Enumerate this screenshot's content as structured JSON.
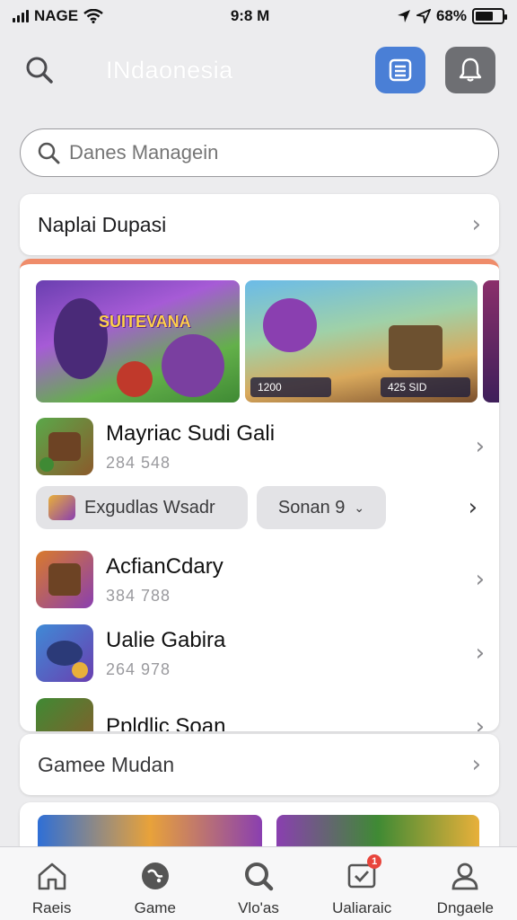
{
  "status_bar": {
    "carrier": "NAGE",
    "time": "9:8 M",
    "battery": "68%",
    "battery_level": 0.68
  },
  "header": {
    "title": "INdaonesia",
    "search_icon": "search-icon",
    "list_icon": "list-icon",
    "bell_icon": "bell-icon"
  },
  "search": {
    "placeholder": "Danes Managein"
  },
  "top_row": {
    "label": "Naplai Dupasi"
  },
  "main": {
    "banners": [
      {
        "title": "SUITEVANA"
      },
      {
        "hud_left": "1200",
        "hud_right": "425 SID"
      },
      {}
    ],
    "games": [
      {
        "name": "Mayriac Sudi Gali",
        "count": "284 548"
      },
      {
        "name": "AcfianCdary",
        "count": "384 788"
      },
      {
        "name": "Ualie Gabira",
        "count": "264 978"
      },
      {
        "name": "Ppldlic Soan",
        "count": ""
      }
    ],
    "chips": [
      {
        "label": "Exgudlas Wsadr"
      },
      {
        "label": "Sonan 9"
      }
    ]
  },
  "section_row": {
    "label": "Gamee Mudan"
  },
  "tabs": [
    {
      "label": "Raeis",
      "icon": "home-icon"
    },
    {
      "label": "Game",
      "icon": "game-icon"
    },
    {
      "label": "Vlo'as",
      "icon": "search-icon"
    },
    {
      "label": "Ualiaraic",
      "icon": "inbox-icon",
      "badge": "1"
    },
    {
      "label": "Dngaele",
      "icon": "profile-icon"
    }
  ],
  "colors": {
    "accent_blue": "#4a7fd6",
    "accent_orange": "#ef8c6a",
    "badge_red": "#e8453c"
  }
}
